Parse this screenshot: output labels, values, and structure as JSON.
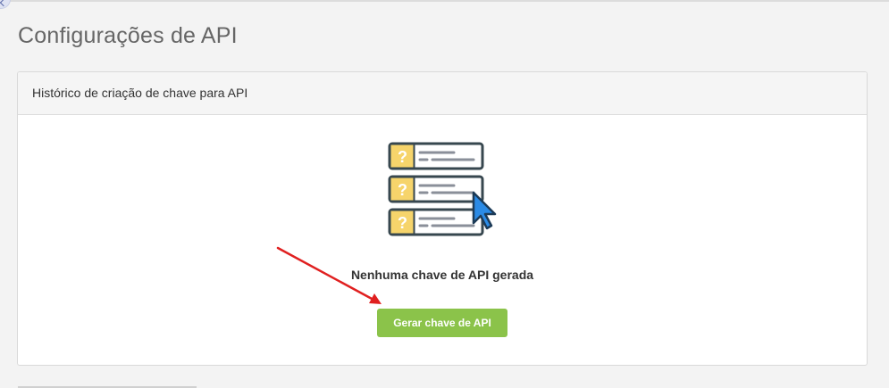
{
  "page": {
    "title": "Configurações de API"
  },
  "panel": {
    "heading": "Histórico de criação de chave para API",
    "empty_message": "Nenhuma chave de API gerada",
    "generate_button_label": "Gerar chave de API"
  },
  "icons": {
    "sidebar_toggle": "chevron-left-icon",
    "illustration": "empty-api-keys-illustration",
    "annotation": "red-arrow-annotation"
  },
  "colors": {
    "button_bg": "#8bc34a",
    "card_fill": "#f6d46b",
    "card_outline": "#37474f",
    "cursor": "#2b8be6",
    "annotation_arrow": "#e02020"
  }
}
